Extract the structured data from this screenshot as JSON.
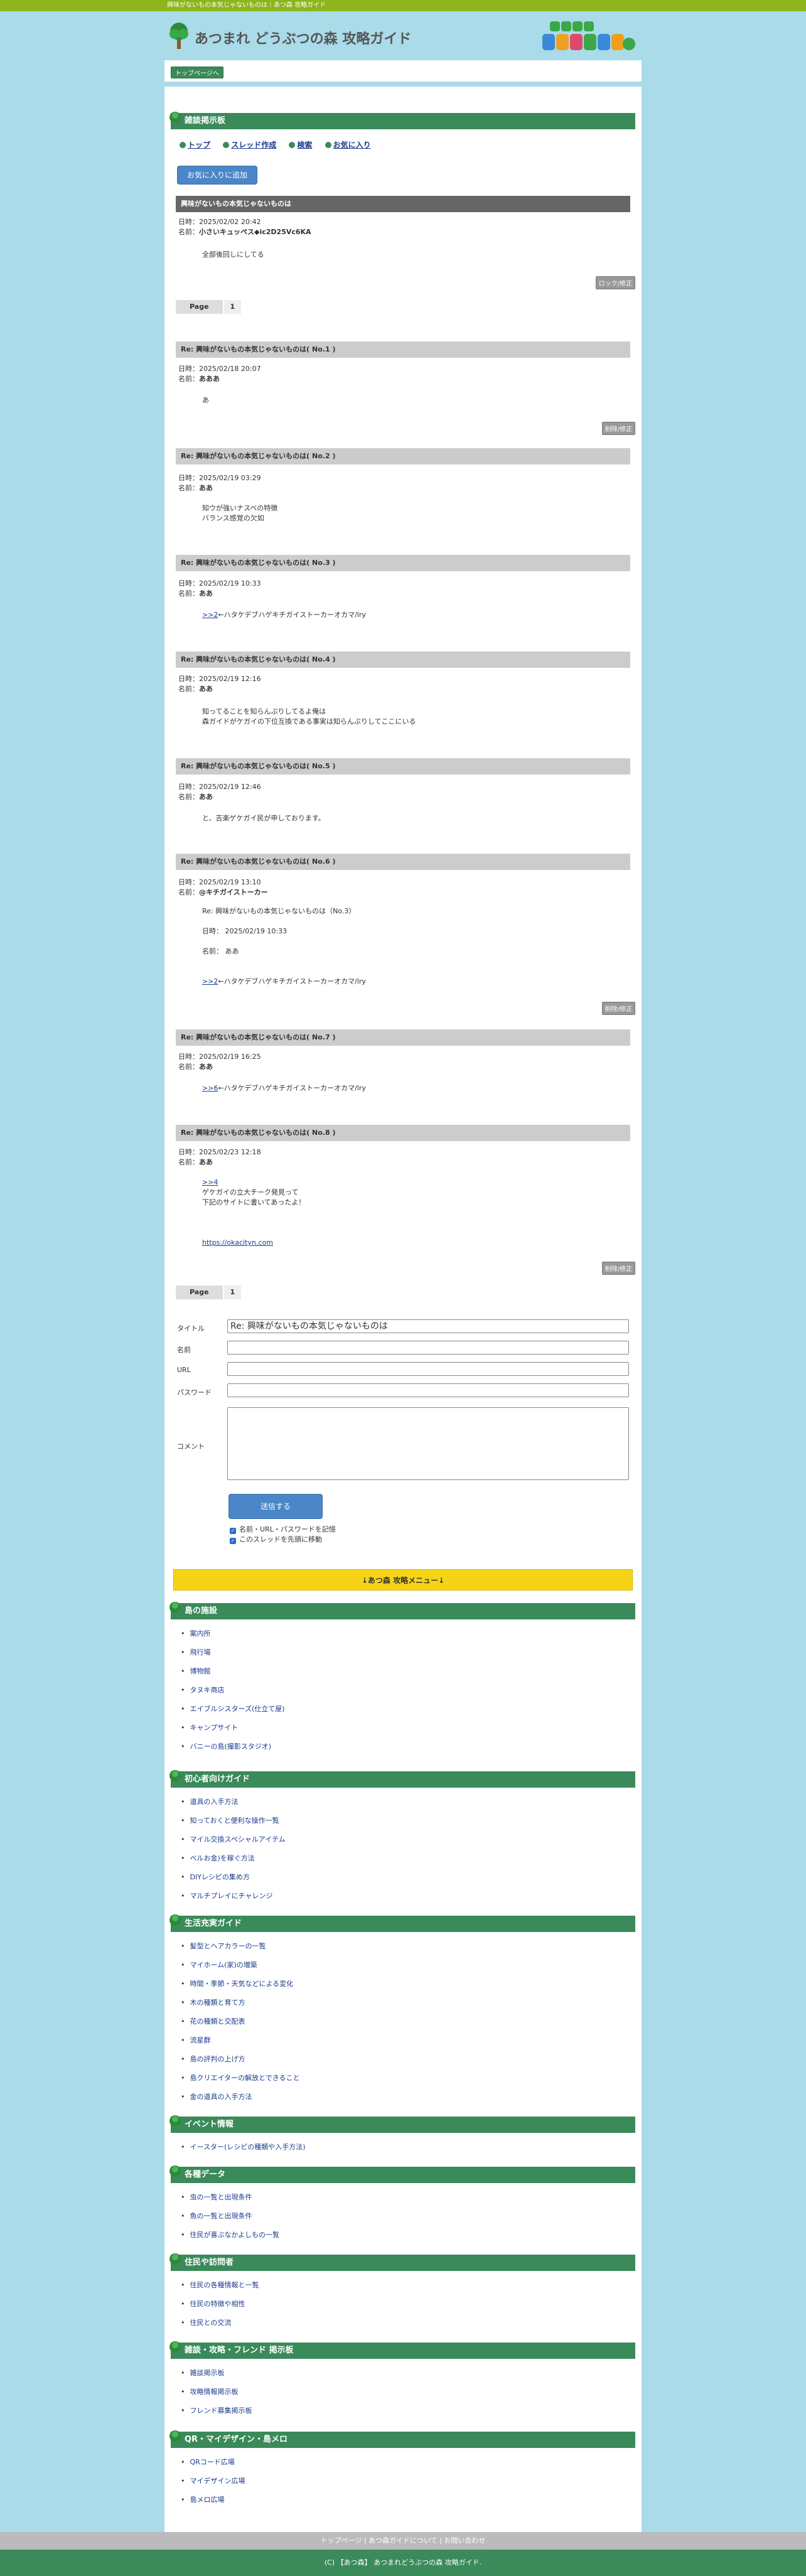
{
  "topbar": "興味がないもの本気じゃないものは｜あつ森 攻略ガイド",
  "site_title": "あつまれ どうぶつの森 攻略ガイド",
  "breadcrumb": "トップページへ",
  "board_title": "雑談掲示板",
  "nav": [
    "トップ",
    "スレッド作成",
    "検索",
    "お気に入り"
  ],
  "fav_button": "お気に入りに追加",
  "thread": {
    "title": "興味がないもの本気じゃないものは",
    "date": "日時：2025/02/02 20:42",
    "name_label": "名前：",
    "name": "小さいキュッペス◆ic2D25Vc6KA",
    "body": "全部後回しにしてる",
    "lock_button": "ロック/修正"
  },
  "pager": {
    "label": "Page",
    "num": "1"
  },
  "replies": [
    {
      "title": "Re: 興味がないもの本気じゃないものは( No.1 )",
      "date": "日時：2025/02/18 20:07",
      "name": "あああ",
      "body": "あ",
      "btn": "削除/修正"
    },
    {
      "title": "Re: 興味がないもの本気じゃないものは( No.2 )",
      "date": "日時：2025/02/19 03:29",
      "name": "ああ",
      "body": "知ウが強いナスベの特徴\nバランス感覚の欠如",
      "btn": ""
    },
    {
      "title": "Re: 興味がないもの本気じゃないものは( No.3 )",
      "date": "日時：2025/02/19 10:33",
      "name": "ああ",
      "body_link": ">>2",
      "body": "←ハタケデブハゲキチガイストーカーオカマ/lry",
      "btn": ""
    },
    {
      "title": "Re: 興味がないもの本気じゃないものは( No.4 )",
      "date": "日時：2025/02/19 12:16",
      "name": "ああ",
      "body": "知ってることを知らんぷりしてるよ俺は\n森ガイドがケガイの下位互換である事実は知らんぷりしてここにいる",
      "btn": ""
    },
    {
      "title": "Re: 興味がないもの本気じゃないものは( No.5 )",
      "date": "日時：2025/02/19 12:46",
      "name": "ああ",
      "body": "と、吉楽ゲケガイ民が申しております。",
      "btn": ""
    },
    {
      "title": "Re: 興味がないもの本気じゃないものは( No.6 )",
      "date": "日時：2025/02/19 13:10",
      "name": "@キチガイストーカー",
      "body": "Re: 興味がないもの本気じゃないものは（No.3）\n\n日時： 2025/02/19 10:33\n\n名前： ああ",
      "body_link": ">>2",
      "body2": "←ハタケデブハゲキチガイストーカーオカマ/lry",
      "btn": "削除/修正"
    },
    {
      "title": "Re: 興味がないもの本気じゃないものは( No.7 )",
      "date": "日時：2025/02/19 16:25",
      "name": "ああ",
      "body_link": ">>6",
      "body": "←ハタケデブハゲキチガイストーカーオカマ/lry",
      "btn": ""
    },
    {
      "title": "Re: 興味がないもの本気じゃないものは( No.8 )",
      "date": "日時：2025/02/23 12:18",
      "name": "ああ",
      "body_link": ">>4",
      "body": "ゲケガイの立大チーク発見って\n下記のサイトに書いてあったよ！",
      "url": "https://okacityn.com",
      "btn": "削除/修正"
    }
  ],
  "form": {
    "title_label": "タイトル",
    "title_value": "Re: 興味がないもの本気じゃないものは",
    "name_label": "名前",
    "url_label": "URL",
    "password_label": "パスワード",
    "comment_label": "コメント",
    "submit": "送信する",
    "check1": "名前・URL・パスワードを記憶",
    "check2": "このスレッドを先頭に移動"
  },
  "menu_button": "↓あつ森 攻略メニュー↓",
  "sections": [
    {
      "title": "島の施設",
      "items": [
        "案内所",
        "飛行場",
        "博物館",
        "タヌキ商店",
        "エイブルシスターズ(仕立て屋)",
        "キャンプサイト",
        "バニーの島(撮影スタジオ)"
      ]
    },
    {
      "title": "初心者向けガイド",
      "items": [
        "道具の入手方法",
        "知っておくと便利な操作一覧",
        "マイル交換スペシャルアイテム",
        "ベルお金)を稼ぐ方法",
        "DIYレシピの集め方",
        "マルチプレイにチャレンジ"
      ]
    },
    {
      "title": "生活充実ガイド",
      "items": [
        "髪型とヘアカラーの一覧",
        "マイホーム(家)の増築",
        "時間・季節・天気などによる変化",
        "木の種類と育て方",
        "花の種類と交配表",
        "流星群",
        "島の評判の上げ方",
        "島クリエイターの解放とできること",
        "金の道具の入手方法"
      ]
    },
    {
      "title": "イベント情報",
      "items": [
        "イースター(レシピの種類や入手方法)"
      ]
    },
    {
      "title": "各種データ",
      "items": [
        "虫の一覧と出現条件",
        "魚の一覧と出現条件",
        "住民が喜ぶなかよしもの一覧"
      ]
    },
    {
      "title": "住民や訪問者",
      "items": [
        "住民の各種情報と一覧",
        "住民の特徴や相性",
        "住民との交流"
      ]
    },
    {
      "title": "雑談・攻略・フレンド 掲示板",
      "items": [
        "雑談掲示板",
        "攻略情報掲示板",
        "フレンド募集掲示板"
      ]
    },
    {
      "title": "QR・マイデザイン・島メロ",
      "items": [
        "QRコード広場",
        "マイデザイン広場",
        "島メロ広場"
      ]
    }
  ],
  "footer": {
    "links": "トップページ | あつ森ガイドについて | お問い合わせ",
    "copyright": "(C) 【あつ森】 あつまれどうぶつの森 攻略ガイド."
  }
}
